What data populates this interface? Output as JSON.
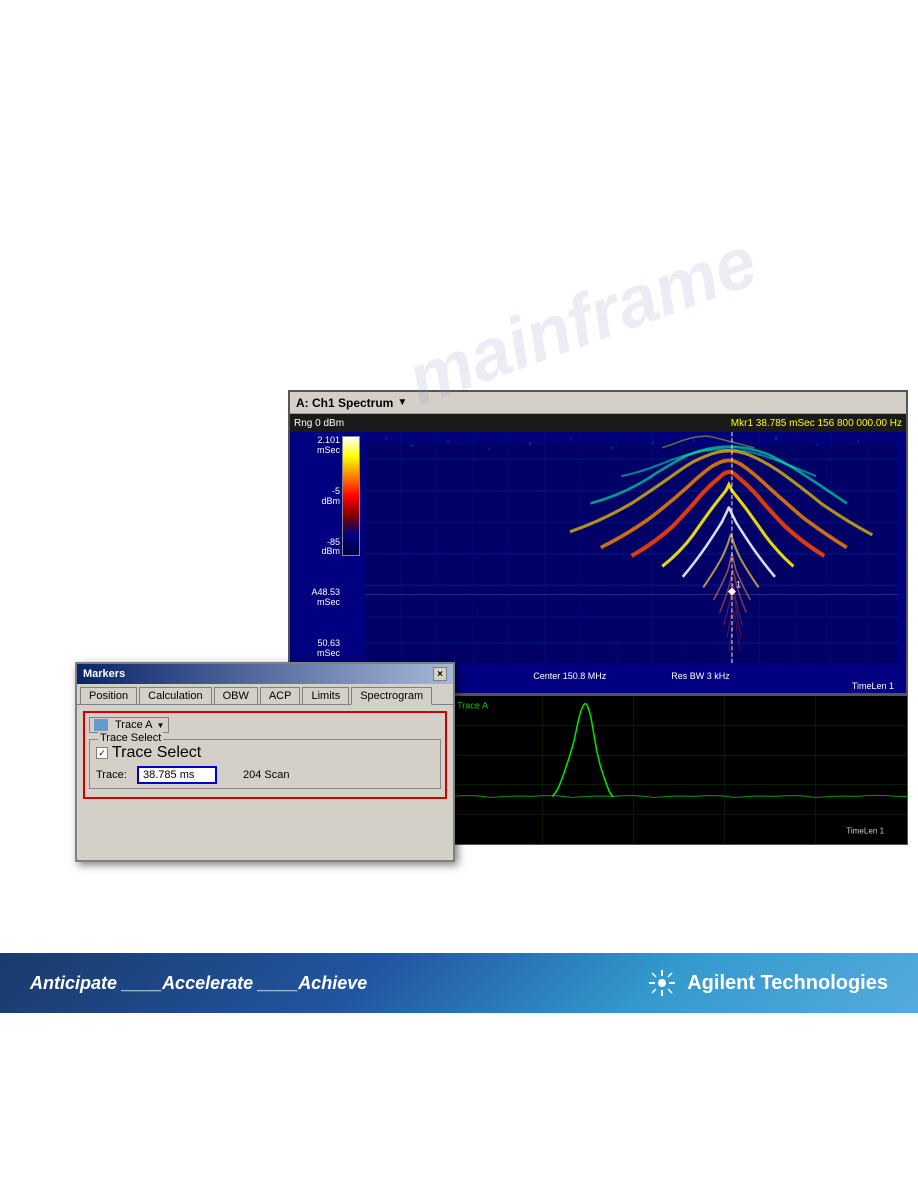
{
  "watermark": {
    "text": "mainframe"
  },
  "spectrum_window": {
    "title": "A: Ch1 Spectrum",
    "info_bar": {
      "rng": "Rng 0 dBm",
      "mkr": "Mkr1   38.785 mSec   156 800 000.00 Hz"
    },
    "y_labels": [
      "2.101\nmSec",
      "-5\ndBm",
      "-85\ndBm",
      "A48.53\nmSec",
      "50.63\nmSec"
    ],
    "bottom": {
      "line1": "Center 150.8 MHz",
      "line2": "Res BW 3 kHz",
      "right": "TimeLen 1"
    }
  },
  "markers_dialog": {
    "title": "Markers",
    "close_button": "×",
    "tabs": [
      {
        "label": "Position",
        "active": false
      },
      {
        "label": "Calculation",
        "active": false
      },
      {
        "label": "OBW",
        "active": false
      },
      {
        "label": "ACP",
        "active": false
      },
      {
        "label": "Limits",
        "active": false
      },
      {
        "label": "Spectrogram",
        "active": true
      }
    ],
    "trace_dropdown": {
      "value": "Trace A",
      "arrow": "▼"
    },
    "trace_select_group": {
      "label": "Trace Select",
      "checkbox_checked": true,
      "checkbox_label": "Trace Select"
    },
    "trace_label": "Trace:",
    "trace_value": "38.785 ms",
    "scan_label": "204 Scan"
  },
  "branding": {
    "tagline": "Anticipate ____Accelerate ____Achieve",
    "company": "Agilent Technologies"
  }
}
